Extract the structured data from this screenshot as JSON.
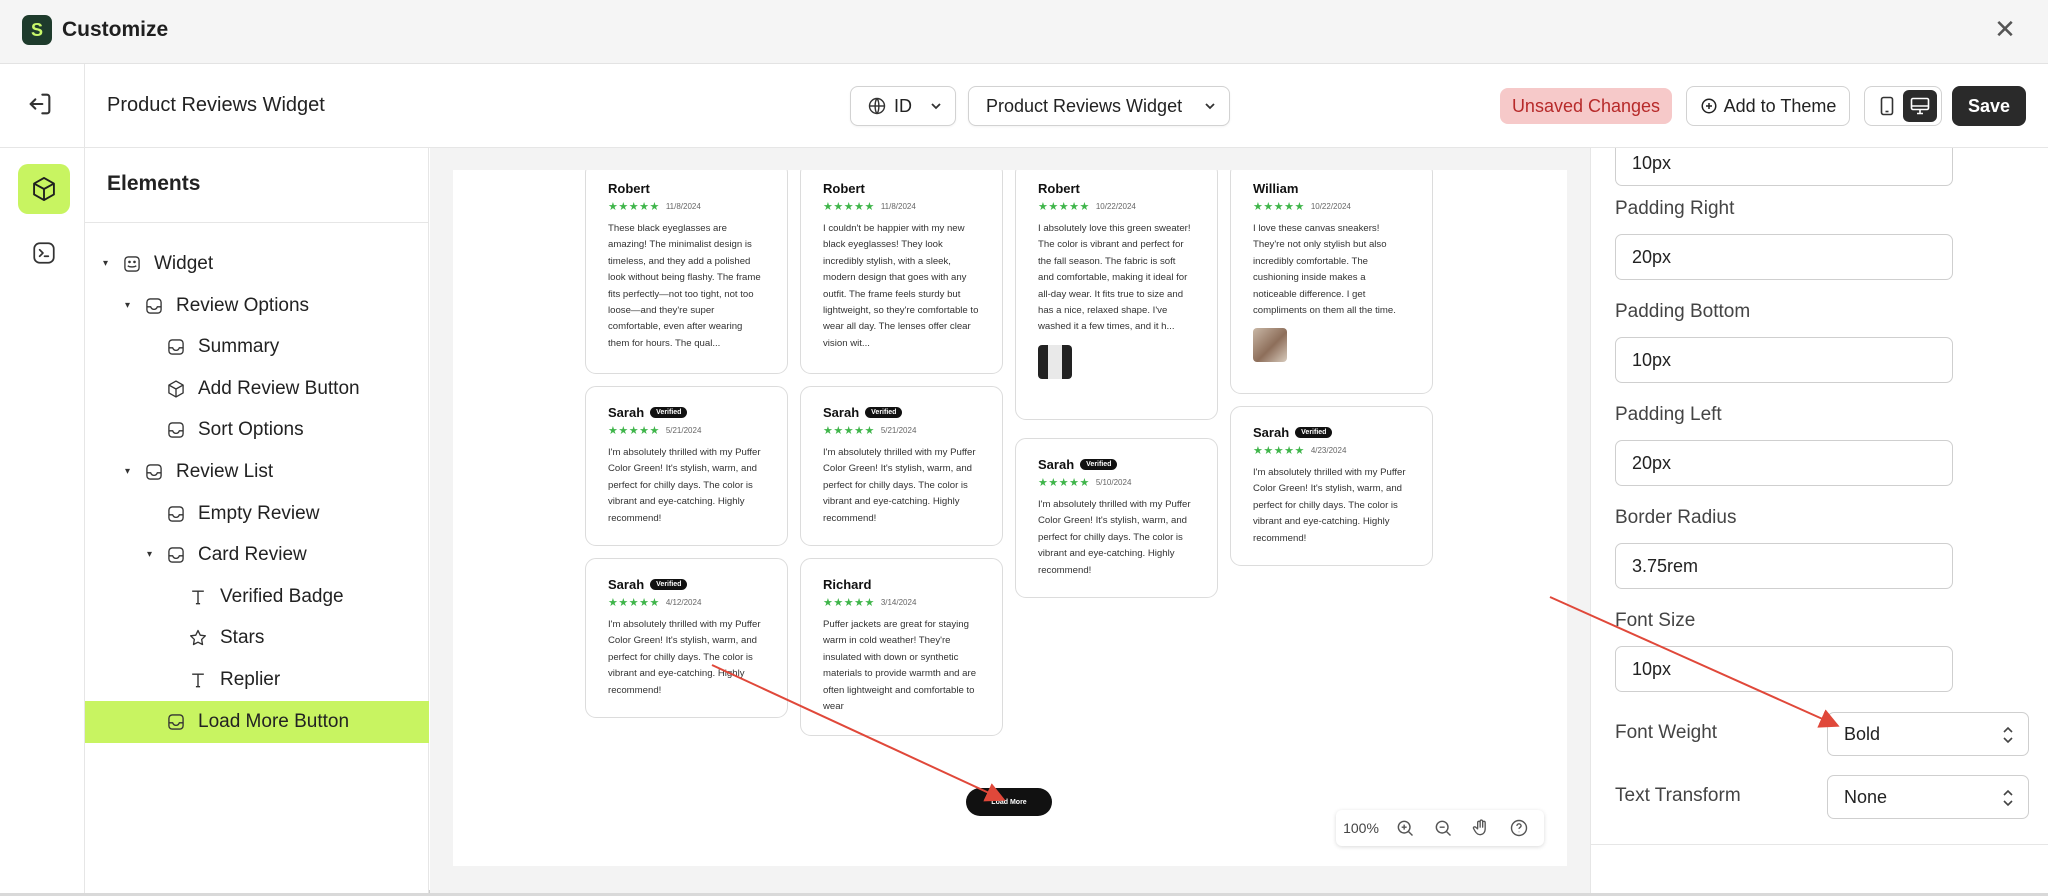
{
  "window": {
    "title": "Customize"
  },
  "toolbar": {
    "page_name": "Product Reviews Widget",
    "language": "ID",
    "widget_select": "Product Reviews Widget",
    "unsaved_label": "Unsaved Changes",
    "add_to_theme_label": "Add to Theme",
    "save_label": "Save"
  },
  "panel": {
    "title": "Elements",
    "tree": [
      {
        "label": "Widget",
        "icon": "widget-icon",
        "level": 0,
        "caret": true
      },
      {
        "label": "Review Options",
        "icon": "box-face-icon",
        "level": 1,
        "caret": true
      },
      {
        "label": "Summary",
        "icon": "box-face-icon",
        "level": 2,
        "caret": false
      },
      {
        "label": "Add Review Button",
        "icon": "cube-icon",
        "level": 2,
        "caret": false
      },
      {
        "label": "Sort Options",
        "icon": "box-face-icon",
        "level": 2,
        "caret": false
      },
      {
        "label": "Review List",
        "icon": "box-face-icon",
        "level": 1,
        "caret": true
      },
      {
        "label": "Empty Review",
        "icon": "box-face-icon",
        "level": 2,
        "caret": false
      },
      {
        "label": "Card Review",
        "icon": "box-face-icon",
        "level": 2,
        "caret": true
      },
      {
        "label": "Verified Badge",
        "icon": "text-icon",
        "level": 3,
        "caret": false
      },
      {
        "label": "Stars",
        "icon": "star-icon",
        "level": 3,
        "caret": false
      },
      {
        "label": "Replier",
        "icon": "text-icon",
        "level": 3,
        "caret": false
      },
      {
        "label": "Load More Button",
        "icon": "box-face-icon",
        "level": 2,
        "caret": false,
        "selected": true
      }
    ]
  },
  "canvas": {
    "reviews": [
      {
        "name": "Robert",
        "verified": false,
        "stars": "★★★★★",
        "date": "11/8/2024",
        "text": "These black eyeglasses are amazing! The minimalist design is timeless, and they add a polished look without being flashy. The frame fits perfectly—not too tight, not too loose—and they're super comfortable, even after wearing them for hours. The qual..."
      },
      {
        "name": "Robert",
        "verified": false,
        "stars": "★★★★★",
        "date": "11/8/2024",
        "text": "I couldn't be happier with my new black eyeglasses! They look incredibly stylish, with a sleek, modern design that goes with any outfit. The frame feels sturdy but lightweight, so they're comfortable to wear all day. The lenses offer clear vision wit..."
      },
      {
        "name": "Robert",
        "verified": false,
        "stars": "★★★★★",
        "date": "10/22/2024",
        "text": "I absolutely love this green sweater! The color is vibrant and perfect for the fall season. The fabric is soft and comfortable, making it ideal for all-day wear. It fits true to size and has a nice, relaxed shape. I've washed it a few times, and it h..."
      },
      {
        "name": "William",
        "verified": false,
        "stars": "★★★★★",
        "date": "10/22/2024",
        "text": "I love these canvas sneakers! They're not only stylish but also incredibly comfortable. The cushioning inside makes a noticeable difference. I get compliments on them all the time."
      },
      {
        "name": "Sarah",
        "verified": true,
        "stars": "★★★★★",
        "date": "5/21/2024",
        "text": "I'm absolutely thrilled with my Puffer Color Green! It's stylish, warm, and perfect for chilly days. The color is vibrant and eye-catching. Highly recommend!"
      },
      {
        "name": "Sarah",
        "verified": true,
        "stars": "★★★★★",
        "date": "5/21/2024",
        "text": "I'm absolutely thrilled with my Puffer Color Green! It's stylish, warm, and perfect for chilly days. The color is vibrant and eye-catching. Highly recommend!"
      },
      {
        "name": "Sarah",
        "verified": true,
        "stars": "★★★★★",
        "date": "5/10/2024",
        "text": "I'm absolutely thrilled with my Puffer Color Green! It's stylish, warm, and perfect for chilly days. The color is vibrant and eye-catching. Highly recommend!"
      },
      {
        "name": "Sarah",
        "verified": true,
        "stars": "★★★★★",
        "date": "4/23/2024",
        "text": "I'm absolutely thrilled with my Puffer Color Green! It's stylish, warm, and perfect for chilly days. The color is vibrant and eye-catching. Highly recommend!"
      },
      {
        "name": "Sarah",
        "verified": true,
        "stars": "★★★★★",
        "date": "4/12/2024",
        "text": "I'm absolutely thrilled with my Puffer Color Green! It's stylish, warm, and perfect for chilly days. The color is vibrant and eye-catching. Highly recommend!"
      },
      {
        "name": "Richard",
        "verified": false,
        "stars": "★★★★★",
        "date": "3/14/2024",
        "text": "Puffer jackets are great for staying warm in cold weather! They're insulated with down or synthetic materials to provide warmth and are often lightweight and comfortable to wear"
      }
    ],
    "verified_label": "Verified",
    "load_more_label": "Load More",
    "zoom": "100%"
  },
  "settings": {
    "top_value": "10px",
    "padding_right_label": "Padding Right",
    "padding_right": "20px",
    "padding_bottom_label": "Padding Bottom",
    "padding_bottom": "10px",
    "padding_left_label": "Padding Left",
    "padding_left": "20px",
    "border_radius_label": "Border Radius",
    "border_radius": "3.75rem",
    "font_size_label": "Font Size",
    "font_size": "10px",
    "font_weight_label": "Font Weight",
    "font_weight": "Bold",
    "text_transform_label": "Text Transform",
    "text_transform": "None"
  },
  "colors": {
    "accent": "#c8f461",
    "annotation": "#e0483a",
    "stars": "#3fb54a",
    "unsaved_bg": "#f6c9c9"
  }
}
